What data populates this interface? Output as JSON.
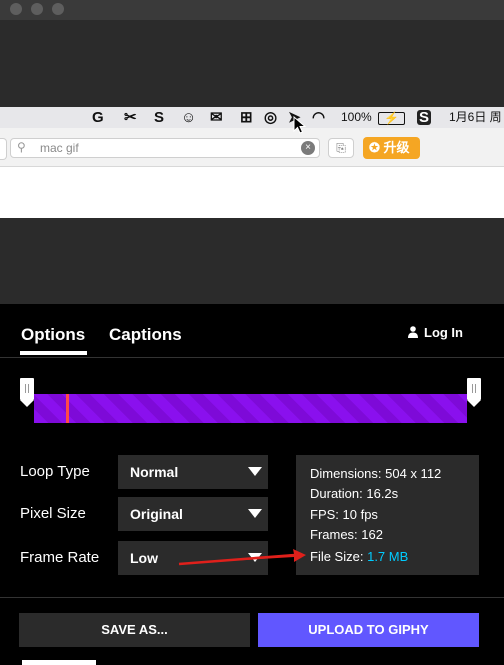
{
  "window": {
    "title_dots": 3
  },
  "menubar": {
    "items": [
      {
        "icon": "G",
        "name": "grammarly-icon"
      },
      {
        "icon": "✂",
        "name": "scissors-icon"
      },
      {
        "icon": "S",
        "name": "app-s-icon"
      },
      {
        "icon": "☺",
        "name": "chat-bubble-icon"
      },
      {
        "icon": "✉",
        "name": "wechat-icon"
      },
      {
        "icon": "⊞",
        "name": "grid-app-icon"
      },
      {
        "icon": "◎",
        "name": "search-app-icon"
      },
      {
        "icon": "➤",
        "name": "send-icon"
      },
      {
        "icon": "◠",
        "name": "wifi-icon"
      }
    ],
    "battery_percent": "100%",
    "battery_icon": "⚡",
    "sogou_icon": "S",
    "date_text": "1月6日 周"
  },
  "toolbar": {
    "search_value": "mac gif",
    "search_icon": "⚲",
    "clear_icon": "×",
    "history_icon": "⎘",
    "upgrade_label": "升级",
    "upgrade_icon": "✪"
  },
  "tabs": [
    {
      "label": "Options",
      "active": true
    },
    {
      "label": "Captions",
      "active": false
    }
  ],
  "login": {
    "label": "Log In",
    "icon": "👤"
  },
  "slider": {
    "start": 0.0,
    "end": 1.0,
    "playhead": 0.075
  },
  "settings": {
    "loop_type": {
      "label": "Loop Type",
      "value": "Normal"
    },
    "pixel_size": {
      "label": "Pixel Size",
      "value": "Original"
    },
    "frame_rate": {
      "label": "Frame Rate",
      "value": "Low"
    }
  },
  "info": {
    "dimensions": "Dimensions: 504 x 112",
    "duration": "Duration: 16.2s",
    "fps": "FPS: 10 fps",
    "frames": "Frames: 162",
    "file_size_label": "File Size:",
    "file_size_value": "1.7 MB"
  },
  "buttons": {
    "save_as": "SAVE AS...",
    "upload": "UPLOAD TO GIPHY"
  },
  "colors": {
    "accent_purple": "#8a10ee",
    "upload_button": "#6157ff",
    "link_blue": "#00ccff",
    "annotation_arrow": "#e0201b",
    "upgrade_orange": "#f5a623"
  }
}
